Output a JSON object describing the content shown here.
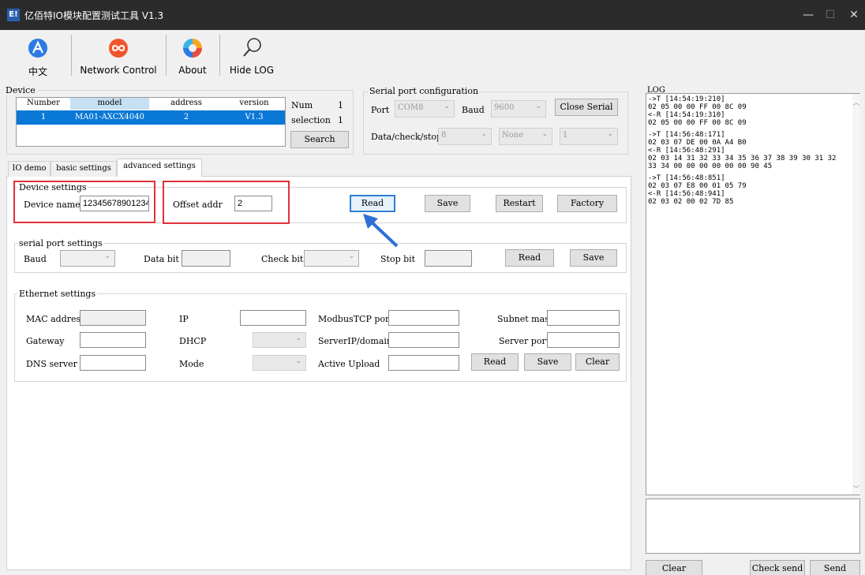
{
  "window": {
    "title": "亿佰特IO模块配置测试工具 V1.3",
    "app_icon_text": "E!",
    "controls": {
      "minimize": "—",
      "maximize": "☐",
      "close": "✕"
    }
  },
  "toolbar": {
    "chinese": "中文",
    "network_control": "Network Control",
    "about": "About",
    "hide_log": "Hide LOG"
  },
  "device": {
    "group_title": "Device",
    "columns": [
      "Number",
      "model",
      "address",
      "version"
    ],
    "rows": [
      {
        "number": "1",
        "model": "MA01-AXCX4040",
        "address": "2",
        "version": "V1.3"
      }
    ],
    "num_label": "Num",
    "num_value": "1",
    "selection_label": "selection",
    "selection_value": "1",
    "search": "Search"
  },
  "serial_config": {
    "group_title": "Serial port configuration",
    "port_label": "Port",
    "port_value": "COM8",
    "baud_label": "Baud",
    "baud_value": "9600",
    "close_serial": "Close Serial",
    "dcs_label": "Data/check/stop",
    "data_value": "8",
    "check_value": "None",
    "stop_value": "1"
  },
  "tabs": [
    "IO demo",
    "basic settings",
    "advanced settings"
  ],
  "device_settings": {
    "group_title": "Device settings",
    "name_label": "Device name",
    "name_value": "12345678901234",
    "offset_label": "Offset addr",
    "offset_value": "2",
    "read": "Read",
    "save": "Save",
    "restart": "Restart",
    "factory": "Factory"
  },
  "serial_settings": {
    "group_title": "serial port settings",
    "baud_label": "Baud",
    "data_bit_label": "Data bit",
    "check_bit_label": "Check bit",
    "stop_bit_label": "Stop bit",
    "read": "Read",
    "save": "Save"
  },
  "ethernet": {
    "group_title": "Ethernet settings",
    "mac_label": "MAC address",
    "ip_label": "IP",
    "modbus_port_label": "ModbusTCP port",
    "subnet_label": "Subnet mask",
    "gateway_label": "Gateway",
    "dhcp_label": "DHCP",
    "server_label": "ServerIP/domain",
    "server_port_label": "Server port",
    "dns_label": "DNS server",
    "mode_label": "Mode",
    "active_upload_label": "Active Upload",
    "read": "Read",
    "save": "Save",
    "clear": "Clear"
  },
  "log": {
    "title": "LOG",
    "lines": [
      "->T [14:54:19:210]",
      "02 05 00 00 FF 00 8C 09",
      "<-R [14:54:19:310]",
      "02 05 00 00 FF 00 8C 09",
      "",
      "->T [14:56:48:171]",
      "02 03 07 DE 00 0A A4 B0",
      "<-R [14:56:48:291]",
      "02 03 14 31 32 33 34 35 36 37 38 39 30 31 32",
      "33 34 00 00 00 00 00 00 90 45",
      "",
      "->T [14:56:48:851]",
      "02 03 07 E8 00 01 05 79",
      "<-R [14:56:48:941]",
      "02 03 02 00 02 7D 85"
    ],
    "clear": "Clear",
    "check_send": "Check send",
    "send": "Send"
  },
  "colors": {
    "title_bar": "#2b2b2b",
    "selected_row": "#0a78d7",
    "highlight_red": "#e0303a",
    "arrow_blue": "#2f6fd6"
  }
}
